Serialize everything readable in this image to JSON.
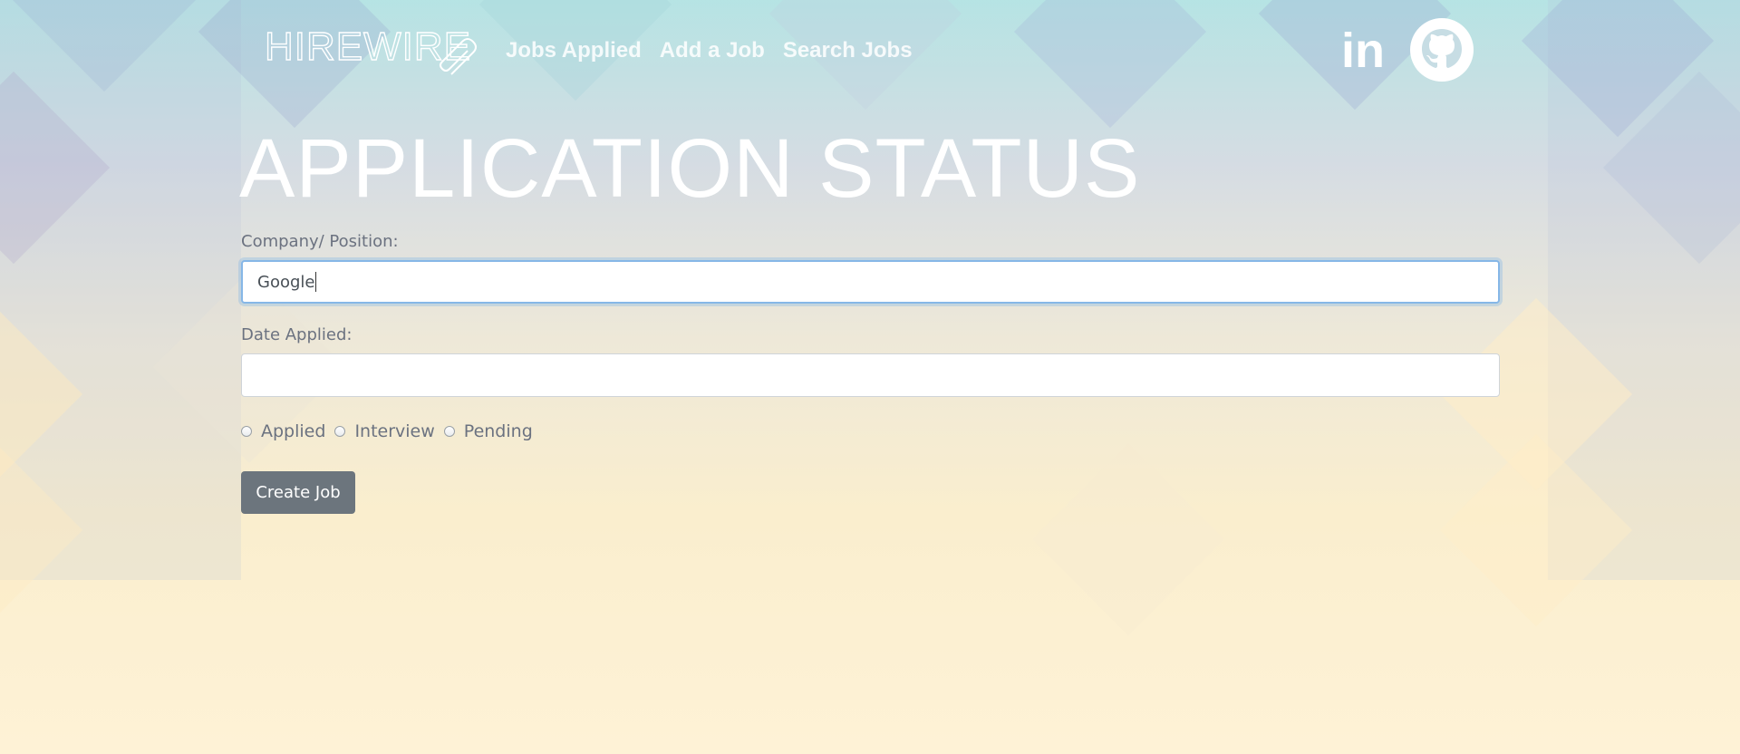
{
  "header": {
    "logo_text": "HIREWIRE",
    "nav": [
      {
        "label": "Jobs Applied"
      },
      {
        "label": "Add a Job"
      },
      {
        "label": "Search Jobs"
      }
    ],
    "social": [
      {
        "icon": "linkedin-icon",
        "text": "in"
      },
      {
        "icon": "github-icon"
      }
    ]
  },
  "page": {
    "title": "APPLICATION STATUS"
  },
  "form": {
    "company": {
      "label": "Company/ Position:",
      "value": "Google",
      "focused": true
    },
    "date": {
      "label": "Date Applied:",
      "value": ""
    },
    "status_options": [
      {
        "label": "Applied",
        "checked": false
      },
      {
        "label": "Interview",
        "checked": false
      },
      {
        "label": "Pending",
        "checked": false
      }
    ],
    "submit_label": "Create Job"
  },
  "colors": {
    "button_bg": "#6c757d",
    "focus_border": "#86b7e7",
    "label_text": "#6b7280",
    "title_text": "#ffffff"
  }
}
